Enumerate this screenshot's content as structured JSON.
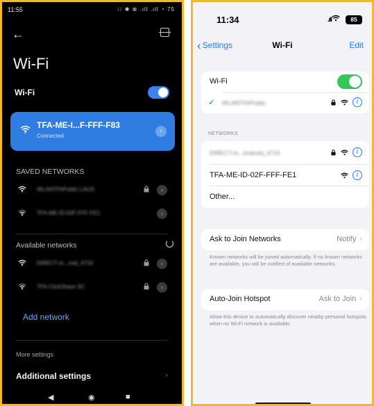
{
  "android": {
    "status_time": "11:55",
    "status_icons": "⁝⁝ ✱ ⊗ .ıll .ıll ◔ 75",
    "title": "Wi-Fi",
    "wifi_label": "Wi-Fi",
    "connected": {
      "name": "TFA-ME-I...F-FFF-F83",
      "status": "Connected"
    },
    "saved_header": "SAVED NETWORKS",
    "saved_networks": [
      {
        "name": "WLANTFAPublic  LAUS"
      },
      {
        "name": "TFA-ME-ID-02F-FFF-FE1"
      }
    ],
    "available_header": "Available networks",
    "available_networks": [
      {
        "name": "DIRECT-m...roid_4719"
      },
      {
        "name": "TFA-ClickShare  SC"
      }
    ],
    "add_network": "Add network",
    "more_settings": "More settings",
    "additional_settings": "Additional settings"
  },
  "ios": {
    "status_time": "11:34",
    "battery": "85",
    "back_label": "Settings",
    "title": "Wi-Fi",
    "edit_label": "Edit",
    "wifi_label": "Wi-Fi",
    "connected_network": "WLANTFAPublic",
    "networks_header": "NETWORKS",
    "networks": [
      {
        "name": "DIRECT-m...Android_4719"
      },
      {
        "name": "TFA-ME-ID-02F-FFF-FE1"
      },
      {
        "name": "Other..."
      }
    ],
    "ask_join": {
      "label": "Ask to Join Networks",
      "value": "Notify"
    },
    "ask_join_footer": "Known networks will be joined automatically. If no known networks are available, you will be notified of available networks.",
    "auto_join": {
      "label": "Auto-Join Hotspot",
      "value": "Ask to Join"
    },
    "auto_join_footer": "Allow this device to automatically discover nearby personal hotspots when no Wi-Fi network is available."
  }
}
